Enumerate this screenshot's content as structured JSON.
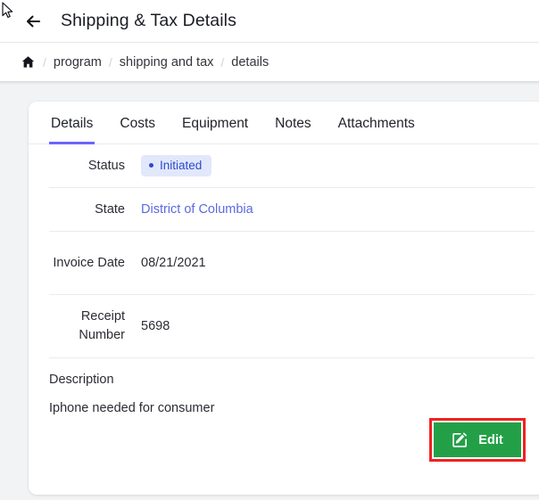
{
  "header": {
    "back_icon": "arrow-left-icon",
    "title": "Shipping & Tax Details"
  },
  "breadcrumb": {
    "home_icon": "home-icon",
    "separator": "/",
    "items": [
      {
        "label": "program"
      },
      {
        "label": "shipping and tax"
      },
      {
        "label": "details"
      }
    ]
  },
  "tabs": [
    {
      "label": "Details",
      "active": true
    },
    {
      "label": "Costs",
      "active": false
    },
    {
      "label": "Equipment",
      "active": false
    },
    {
      "label": "Notes",
      "active": false
    },
    {
      "label": "Attachments",
      "active": false
    }
  ],
  "details": {
    "status": {
      "label": "Status",
      "value": "Initiated",
      "badge_bg": "#e2e8fb",
      "badge_fg": "#2f49c9",
      "dot_icon": "status-dot-icon"
    },
    "state": {
      "label": "State",
      "value": "District of Columbia",
      "link_color": "#5b6ae0"
    },
    "invoice_date": {
      "label": "Invoice Date",
      "value": "08/21/2021"
    },
    "receipt_number": {
      "label": "Receipt Number",
      "value": "5698"
    }
  },
  "description": {
    "label": "Description",
    "text": "Iphone needed for consumer"
  },
  "edit_button": {
    "label": "Edit",
    "icon": "edit-pencil-square-icon",
    "bg_color": "#23a047",
    "highlight_color": "#ee2222"
  },
  "cursor": {
    "icon": "mouse-pointer-icon"
  },
  "theme": {
    "accent": "#6c63ff",
    "page_bg": "#f2f3f5",
    "card_bg": "#ffffff"
  }
}
